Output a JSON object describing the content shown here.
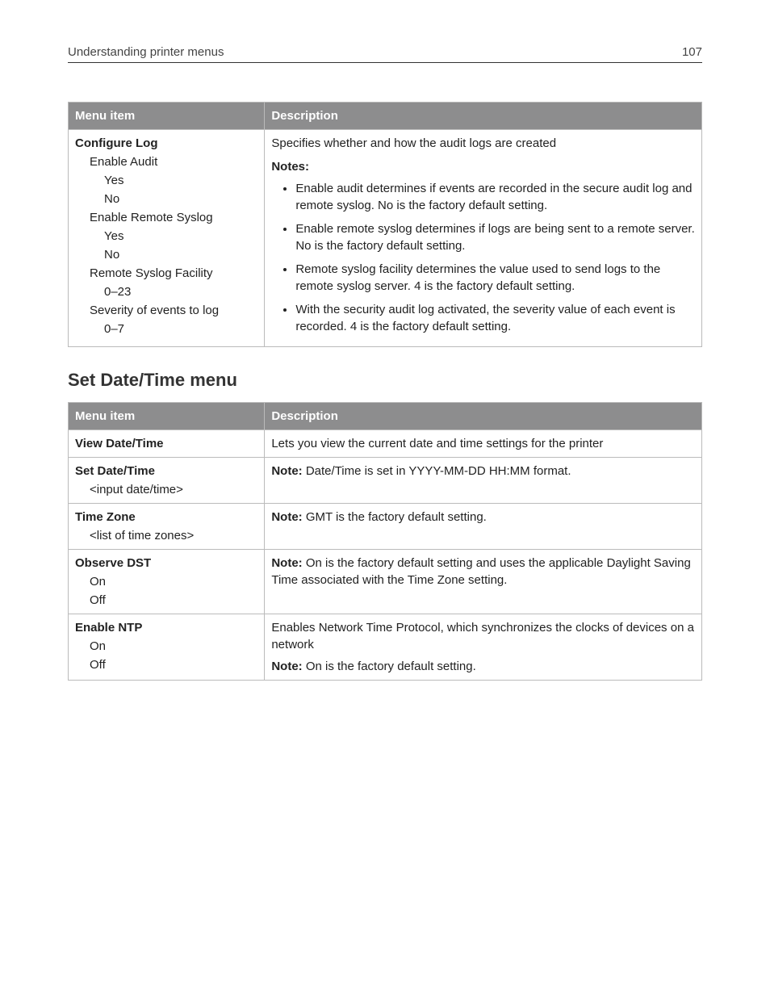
{
  "header": {
    "title": "Understanding printer menus",
    "page_number": "107"
  },
  "table1": {
    "headers": {
      "col1": "Menu item",
      "col2": "Description"
    },
    "row1": {
      "menu": {
        "title": "Configure Log",
        "items": [
          {
            "label": "Enable Audit",
            "opts": [
              "Yes",
              "No"
            ]
          },
          {
            "label": "Enable Remote Syslog",
            "opts": [
              "Yes",
              "No"
            ]
          },
          {
            "label": "Remote Syslog Facility",
            "opts": [
              "0–23"
            ]
          },
          {
            "label": "Severity of events to log",
            "opts": [
              "0–7"
            ]
          }
        ]
      },
      "desc": {
        "intro": "Specifies whether and how the audit logs are created",
        "notes_label": "Notes:",
        "bullets": [
          "Enable audit determines if events are recorded in the secure audit log and remote syslog. No is the factory default setting.",
          "Enable remote syslog determines if logs are being sent to a remote server. No is the factory default setting.",
          "Remote syslog facility determines the value used to send logs to the remote syslog server. 4 is the factory default setting.",
          "With the security audit log activated, the severity value of each event is recorded. 4 is the factory default setting."
        ]
      }
    }
  },
  "section2_title": "Set Date/Time menu",
  "table2": {
    "headers": {
      "col1": "Menu item",
      "col2": "Description"
    },
    "rows": [
      {
        "menu": {
          "title": "View Date/Time",
          "subs": []
        },
        "desc_plain": "Lets you view the current date and time settings for the printer"
      },
      {
        "menu": {
          "title": "Set Date/Time",
          "subs": [
            "<input date/time>"
          ]
        },
        "desc_note_label": "Note:",
        "desc_note_text": " Date/Time is set in YYYY-MM-DD HH:MM format."
      },
      {
        "menu": {
          "title": "Time Zone",
          "subs": [
            "<list of time zones>"
          ]
        },
        "desc_note_label": "Note:",
        "desc_note_text": " GMT is the factory default setting."
      },
      {
        "menu": {
          "title": "Observe DST",
          "subs": [
            "On",
            "Off"
          ]
        },
        "desc_note_label": "Note:",
        "desc_note_text": " On is the factory default setting and uses the applicable Daylight Saving Time associated with the Time Zone setting."
      },
      {
        "menu": {
          "title": "Enable NTP",
          "subs": [
            "On",
            "Off"
          ]
        },
        "desc_plain": "Enables Network Time Protocol, which synchronizes the clocks of devices on a network",
        "desc_note_label": "Note:",
        "desc_note_text": " On is the factory default setting."
      }
    ]
  }
}
